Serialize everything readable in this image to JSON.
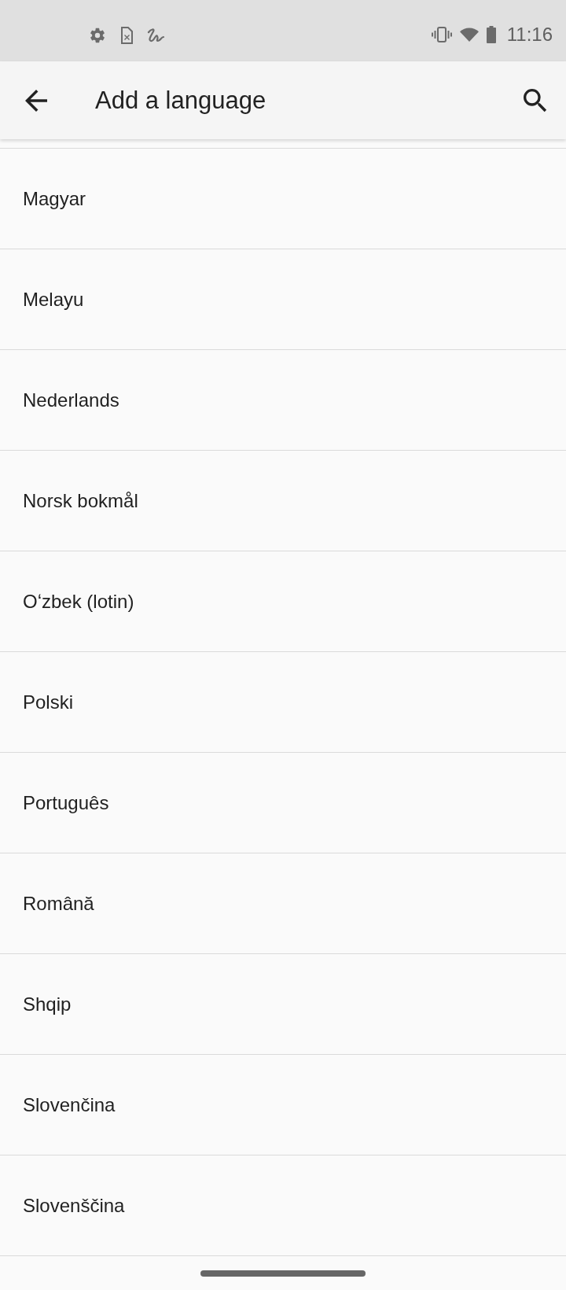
{
  "status_bar": {
    "time": "11:16"
  },
  "app_bar": {
    "title": "Add a language"
  },
  "languages": [
    "Magyar",
    "Melayu",
    "Nederlands",
    "Norsk bokmål",
    "Oʻzbek (lotin)",
    "Polski",
    "Português",
    "Română",
    "Shqip",
    "Slovenčina",
    "Slovenščina"
  ]
}
